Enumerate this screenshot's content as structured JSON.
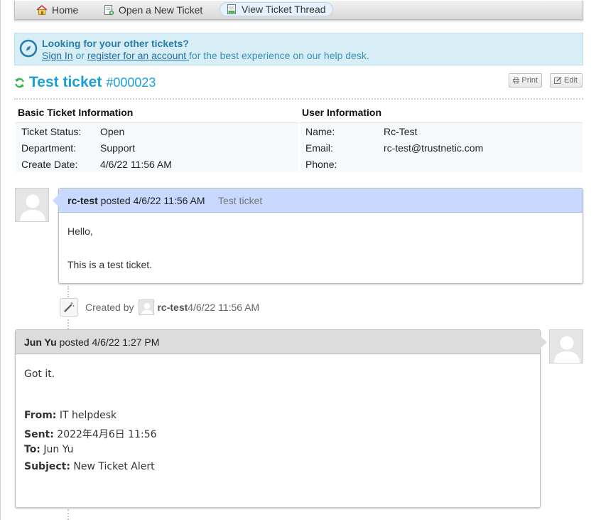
{
  "nav": {
    "items": [
      {
        "label": "Home",
        "icon": "home-icon"
      },
      {
        "label": "Open a New Ticket",
        "icon": "new-ticket-icon"
      },
      {
        "label": "View Ticket Thread",
        "icon": "ticket-thread-icon",
        "active": true
      }
    ]
  },
  "banner": {
    "title": "Looking for your other tickets?",
    "sign_in": "Sign In",
    "or_text": " or ",
    "register": "register for an account ",
    "suffix": "for the best experience on our help desk."
  },
  "ticket": {
    "title": "Test ticket",
    "number": "#000023",
    "print_label": "Print",
    "edit_label": "Edit"
  },
  "basic_info": {
    "heading": "Basic Ticket Information",
    "rows": [
      {
        "label": "Ticket Status:",
        "value": "Open"
      },
      {
        "label": "Department:",
        "value": "Support"
      },
      {
        "label": "Create Date:",
        "value": "4/6/22 11:56 AM"
      }
    ]
  },
  "user_info": {
    "heading": "User Information",
    "rows": [
      {
        "label": "Name:",
        "value": "Rc-Test"
      },
      {
        "label": "Email:",
        "value": "rc-test@trustnetic.com"
      },
      {
        "label": "Phone:",
        "value": ""
      }
    ]
  },
  "thread": {
    "message": {
      "author": "rc-test",
      "posted": " posted 4/6/22 11:56 AM",
      "subject": "Test ticket",
      "lines": [
        "Hello,",
        "This is a test ticket."
      ]
    },
    "event": {
      "created_by": "Created by",
      "user": "rc-test",
      "time": " 4/6/22 11:56 AM"
    },
    "response": {
      "author": "Jun Yu",
      "posted": " posted 4/6/22 1:27 PM",
      "intro": "Got it.",
      "from_label": "From:",
      "from_value": " IT helpdesk",
      "sent_label": "Sent:",
      "sent_value": " 2022年4月6日 11:56",
      "to_label": "To:",
      "to_value": " Jun Yu",
      "subject_label": "Subject:",
      "subject_value": " New Ticket Alert"
    }
  },
  "colors": {
    "accent": "#1aa0d8",
    "banner_bg": "#d8eef6",
    "message_header": "#c7d9ff",
    "response_header": "#dcdcdc",
    "refresh_green": "#2db34a"
  }
}
